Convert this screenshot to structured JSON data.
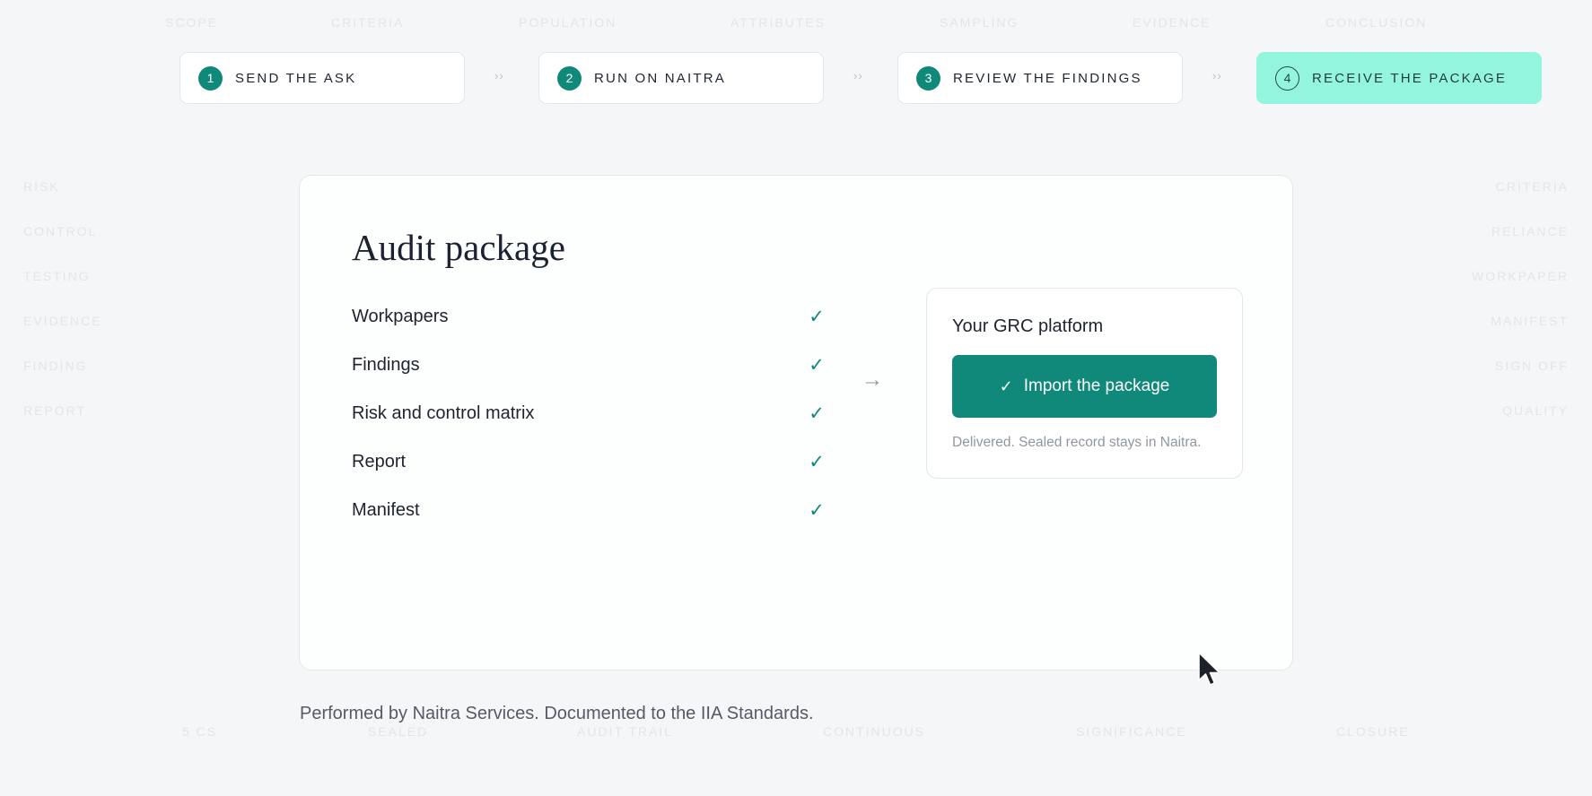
{
  "background": {
    "top": [
      "SCOPE",
      "CRITERIA",
      "POPULATION",
      "ATTRIBUTES",
      "SAMPLING",
      "EVIDENCE",
      "CONCLUSION"
    ],
    "left": [
      "RISK",
      "CONTROL",
      "TESTING",
      "EVIDENCE",
      "FINDING",
      "REPORT"
    ],
    "right": [
      "CRITERIA",
      "RELIANCE",
      "WORKPAPER",
      "MANIFEST",
      "SIGN OFF",
      "QUALITY"
    ],
    "bottom": [
      "5 CS",
      "SEALED",
      "AUDIT TRAIL",
      "CONTINUOUS",
      "SIGNIFICANCE",
      "CLOSURE"
    ]
  },
  "steps": [
    {
      "number": "1",
      "label": "SEND THE ASK"
    },
    {
      "number": "2",
      "label": "RUN ON NAITRA"
    },
    {
      "number": "3",
      "label": "REVIEW THE FINDINGS"
    },
    {
      "number": "4",
      "label": "RECEIVE THE PACKAGE"
    }
  ],
  "step_separator": "››",
  "card": {
    "title": "Audit package",
    "items": [
      {
        "label": "Workpapers",
        "check": "✓"
      },
      {
        "label": "Findings",
        "check": "✓"
      },
      {
        "label": "Risk and control matrix",
        "check": "✓"
      },
      {
        "label": "Report",
        "check": "✓"
      },
      {
        "label": "Manifest",
        "check": "✓"
      }
    ],
    "arrow": "→",
    "grc": {
      "title": "Your GRC platform",
      "button_check": "✓",
      "button_label": "Import the package",
      "note": "Delivered. Sealed record stays in Naitra."
    }
  },
  "footer": "Performed by Naitra Services. Documented to the IIA Standards.",
  "colors": {
    "accent": "#11897a",
    "active_step": "#93f5de",
    "background": "#f5f6f8"
  }
}
